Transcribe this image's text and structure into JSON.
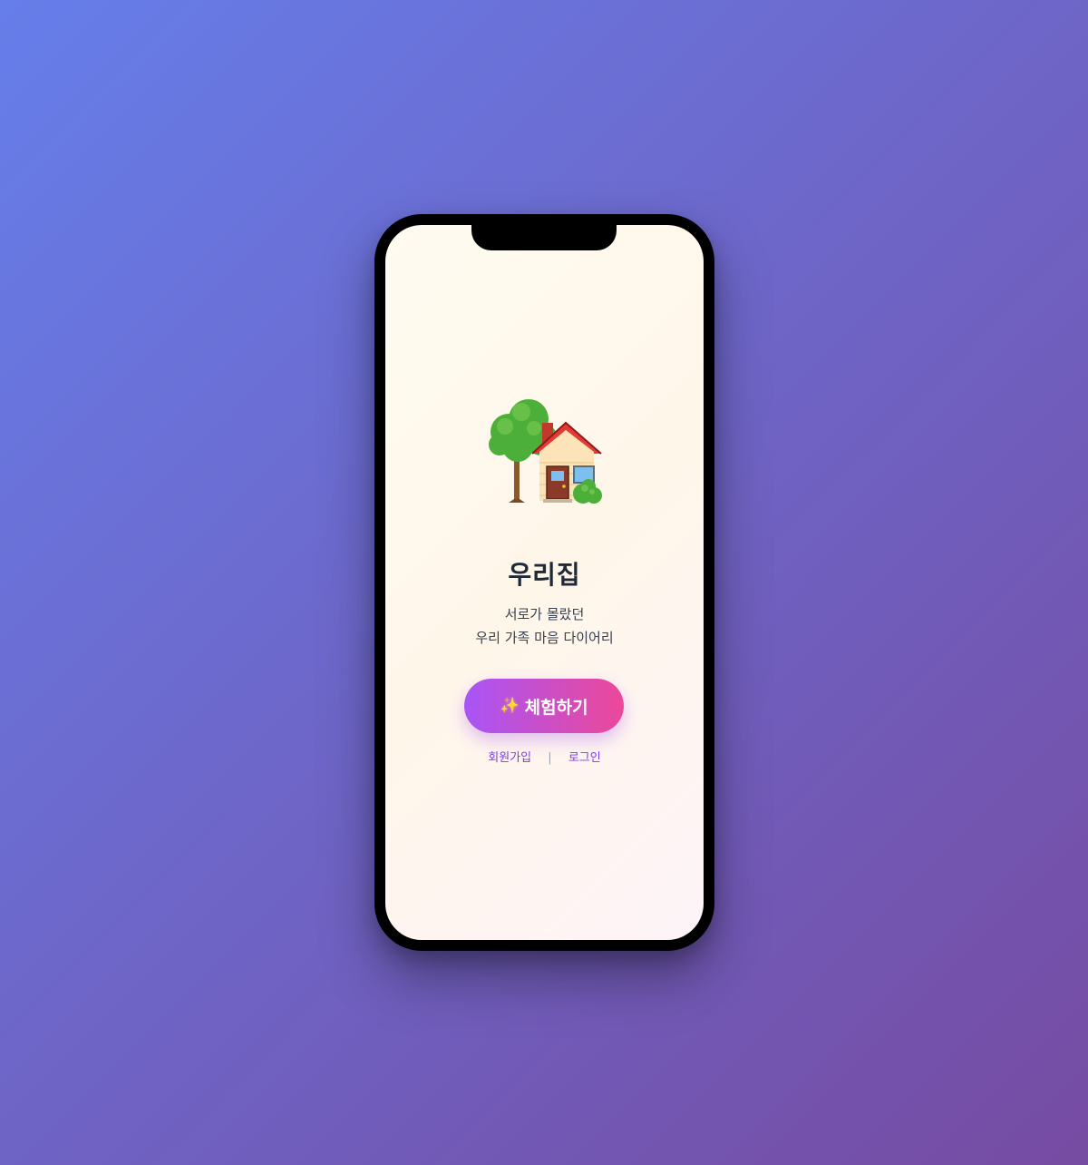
{
  "app": {
    "title": "우리집",
    "subtitle_line1": "서로가 몰랐던",
    "subtitle_line2": "우리 가족 마음 다이어리",
    "hero_icon": "house-with-garden-icon"
  },
  "actions": {
    "try_label": "체험하기",
    "try_icon": "sparkles-icon",
    "signup_label": "회원가입",
    "divider": "|",
    "login_label": "로그인"
  },
  "colors": {
    "background_start": "#667eea",
    "background_end": "#764ba2",
    "button_start": "#a855f7",
    "button_end": "#ec4899",
    "link": "#7c3aed",
    "title": "#1f2937"
  }
}
